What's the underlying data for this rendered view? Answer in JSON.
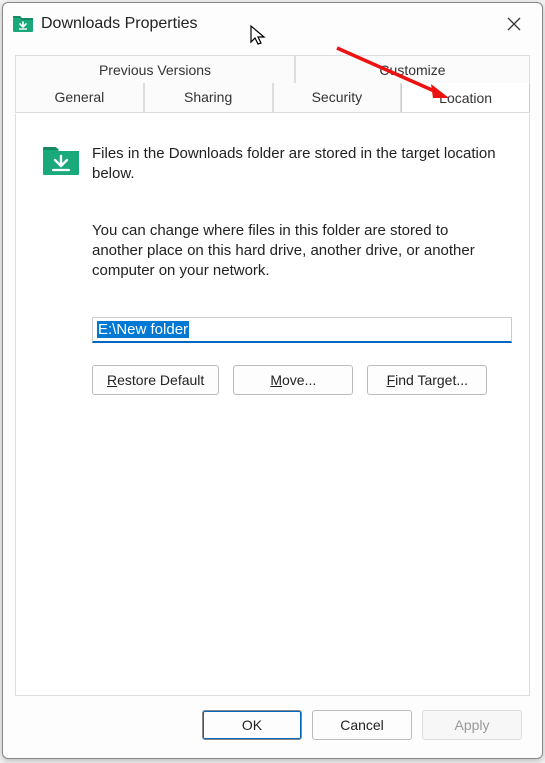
{
  "window": {
    "title": "Downloads Properties"
  },
  "tabs": {
    "row1": {
      "previous_versions": "Previous Versions",
      "customize": "Customize"
    },
    "row2": {
      "general": "General",
      "sharing": "Sharing",
      "security": "Security",
      "location": "Location"
    },
    "active": "Location"
  },
  "location_pane": {
    "info_text": "Files in the Downloads folder are stored in the target location below.",
    "desc_text": "You can change where files in this folder are stored to another place on this hard drive, another drive, or another computer on your network.",
    "path_value": "E:\\New folder",
    "buttons": {
      "restore": "Restore Default",
      "move": "Move...",
      "find_target": "Find Target..."
    }
  },
  "footer": {
    "ok": "OK",
    "cancel": "Cancel",
    "apply": "Apply"
  }
}
